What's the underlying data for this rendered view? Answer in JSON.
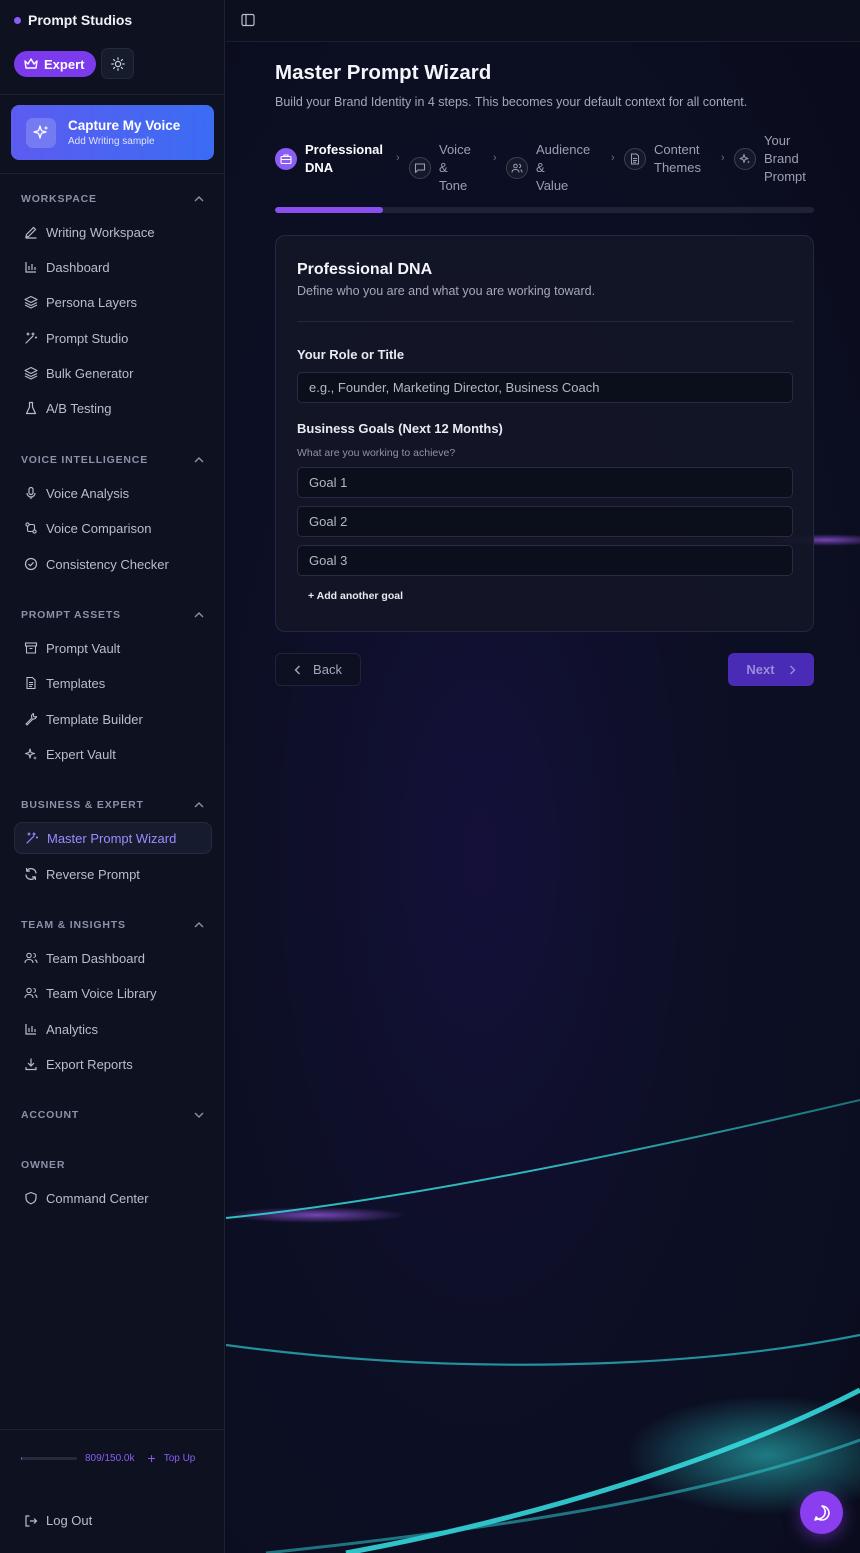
{
  "brand": {
    "name": "Prompt Studios"
  },
  "header": {
    "expert_label": "Expert"
  },
  "capture": {
    "title": "Capture My Voice",
    "subtitle": "Add Writing sample"
  },
  "sections": {
    "workspace": "WORKSPACE",
    "voice": "VOICE INTELLIGENCE",
    "assets": "PROMPT ASSETS",
    "business": "BUSINESS & EXPERT",
    "team": "TEAM & INSIGHTS",
    "account": "ACCOUNT",
    "owner": "OWNER"
  },
  "nav": {
    "writing_workspace": "Writing Workspace",
    "dashboard": "Dashboard",
    "persona_layers": "Persona Layers",
    "prompt_studio": "Prompt Studio",
    "bulk_generator": "Bulk Generator",
    "ab_testing": "A/B Testing",
    "voice_analysis": "Voice Analysis",
    "voice_comparison": "Voice Comparison",
    "consistency_checker": "Consistency Checker",
    "prompt_vault": "Prompt Vault",
    "templates": "Templates",
    "template_builder": "Template Builder",
    "expert_vault": "Expert Vault",
    "master_prompt_wizard": "Master Prompt Wizard",
    "reverse_prompt": "Reverse Prompt",
    "team_dashboard": "Team Dashboard",
    "team_voice_library": "Team Voice Library",
    "analytics": "Analytics",
    "export_reports": "Export Reports",
    "command_center": "Command Center"
  },
  "credits": {
    "text": "809/150.0k",
    "used": 809,
    "total": 150000,
    "top_up": "Top Up"
  },
  "logout": "Log Out",
  "page": {
    "title": "Master Prompt Wizard",
    "subtitle": "Build your Brand Identity in 4 steps. This becomes your default context for all content."
  },
  "steps": [
    {
      "line1": "Professional",
      "line2": "DNA",
      "line3": ""
    },
    {
      "line1": "Voice &",
      "line2": "Tone",
      "line3": ""
    },
    {
      "line1": "Audience &",
      "line2": "Value",
      "line3": ""
    },
    {
      "line1": "Content",
      "line2": "Themes",
      "line3": ""
    },
    {
      "line1": "Your",
      "line2": "Brand",
      "line3": "Prompt"
    }
  ],
  "progress": {
    "current_step": 1,
    "total_steps": 5,
    "fraction": 0.2
  },
  "card": {
    "title": "Professional DNA",
    "subtitle": "Define who you are and what you are working toward.",
    "role_label": "Your Role or Title",
    "role_placeholder": "e.g., Founder, Marketing Director, Business Coach",
    "goals_label": "Business Goals (Next 12 Months)",
    "goals_hint": "What are you working to achieve?",
    "goal1_placeholder": "Goal 1",
    "goal2_placeholder": "Goal 2",
    "goal3_placeholder": "Goal 3",
    "add_goal": "+ Add another goal"
  },
  "buttons": {
    "back": "Back",
    "next": "Next"
  },
  "colors": {
    "accent": "#8b5cf6",
    "capture_gradient_start": "#5b5cf0",
    "capture_gradient_end": "#3b6cf3",
    "next_bg": "#4a2bb5",
    "teal_glow": "#2dd4d4"
  }
}
